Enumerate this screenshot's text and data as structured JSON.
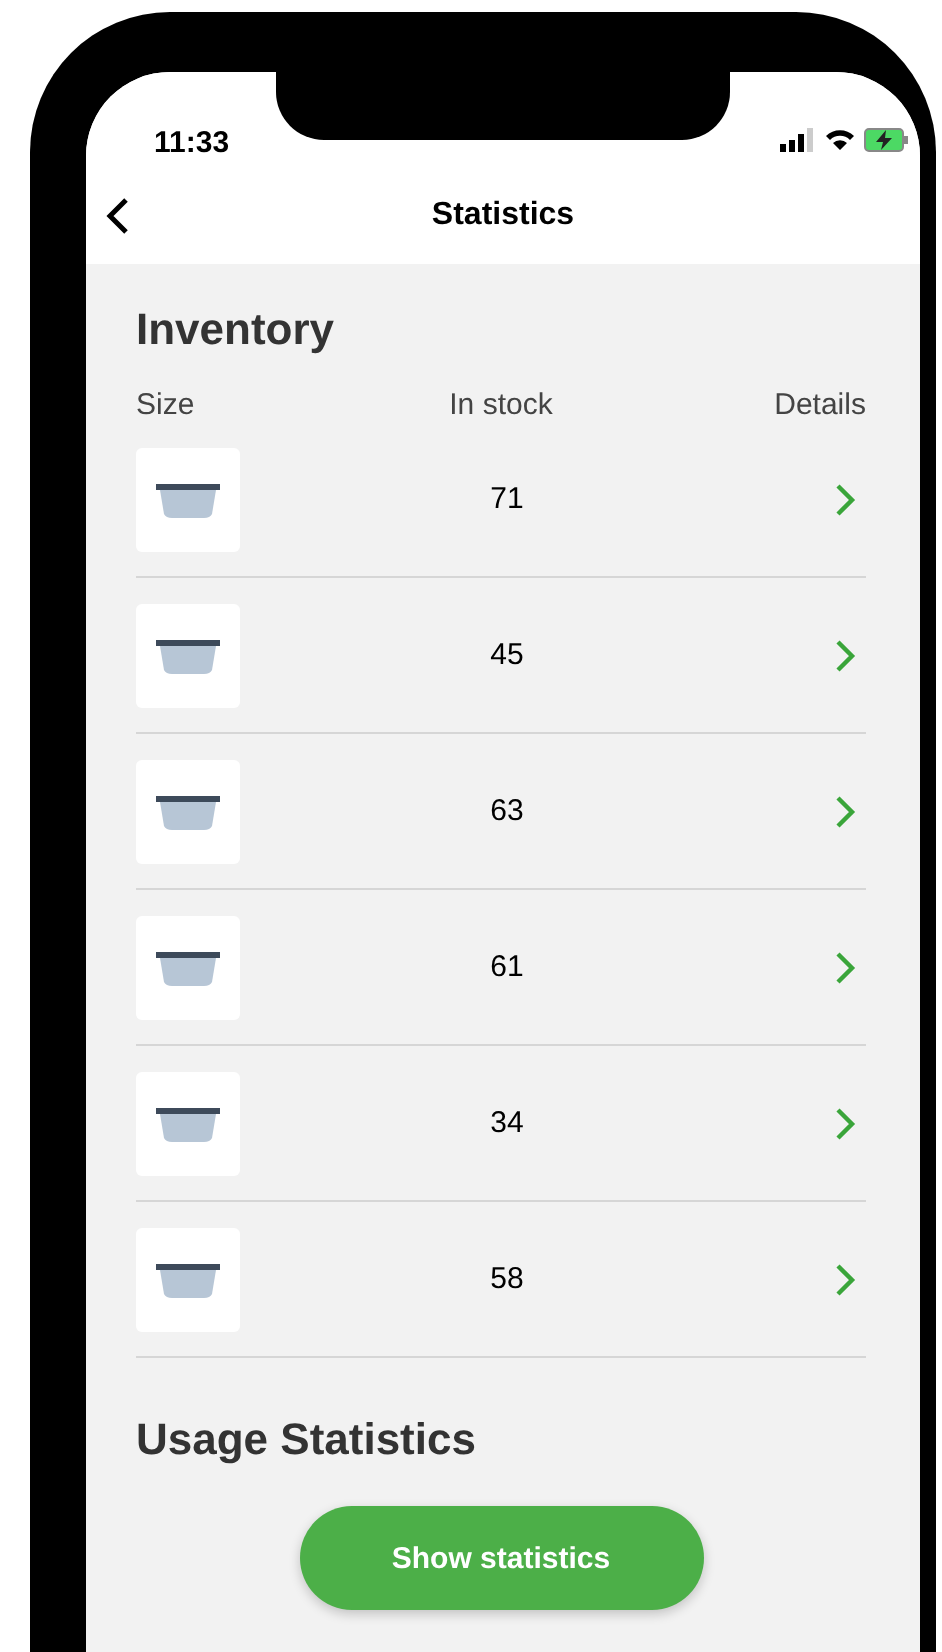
{
  "status_bar": {
    "time": "11:33"
  },
  "nav": {
    "title": "Statistics"
  },
  "inventory": {
    "title": "Inventory",
    "columns": [
      "Size",
      "In stock",
      "Details"
    ],
    "rows": [
      {
        "in_stock": "71"
      },
      {
        "in_stock": "45"
      },
      {
        "in_stock": "63"
      },
      {
        "in_stock": "61"
      },
      {
        "in_stock": "34"
      },
      {
        "in_stock": "58"
      }
    ]
  },
  "usage": {
    "title": "Usage Statistics",
    "button": "Show statistics"
  }
}
